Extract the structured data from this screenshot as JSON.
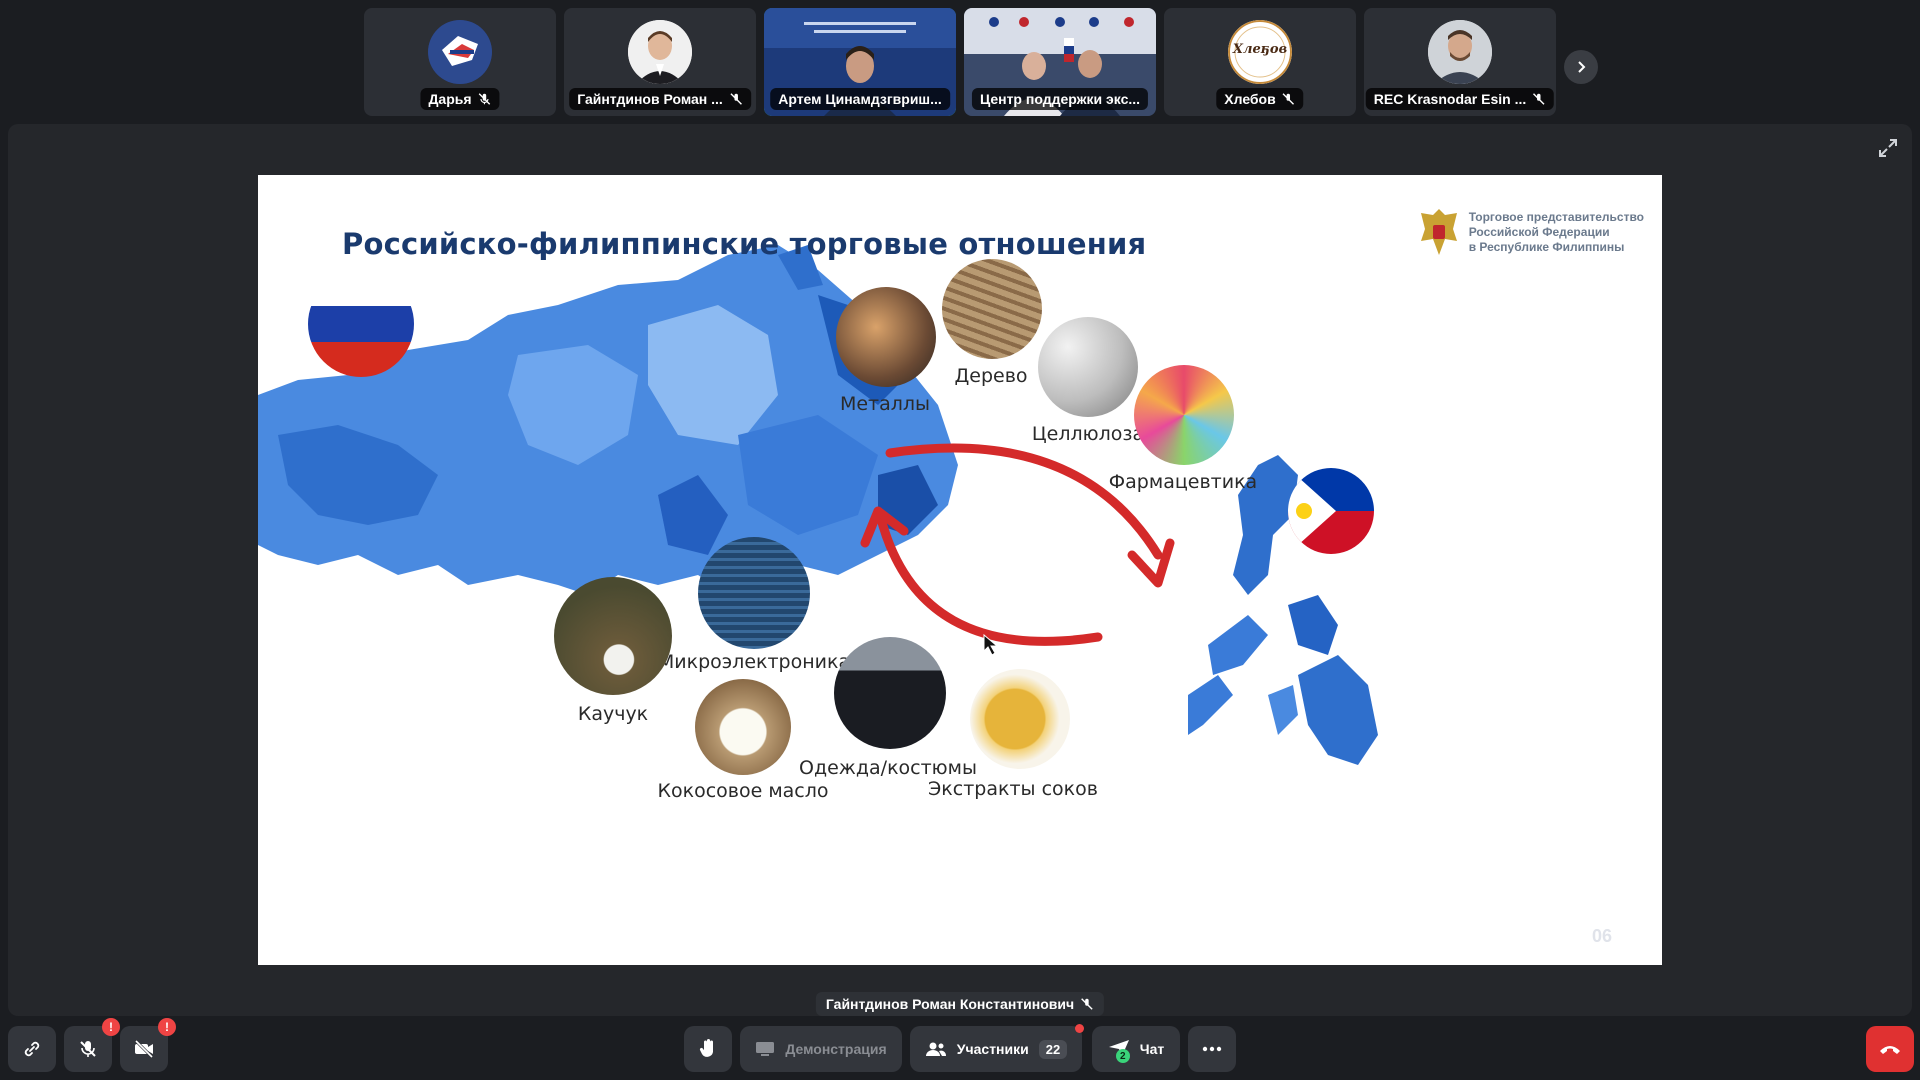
{
  "participants": [
    {
      "name": "Дарья",
      "muted": true,
      "icon": "logo-avatar"
    },
    {
      "name": "Гайнтдинов Роман ...",
      "muted": true,
      "icon": "person-avatar"
    },
    {
      "name": "Артем Цинамдзгвриш...",
      "muted": false,
      "icon": "video-feed",
      "active": true
    },
    {
      "name": "Центр поддержки экс...",
      "muted": false,
      "icon": "video-feed"
    },
    {
      "name": "Хлебов",
      "muted": true,
      "icon": "logo-avatar",
      "logo_text": "Хлеҕов"
    },
    {
      "name": "REC Krasnodar Esin ...",
      "muted": true,
      "icon": "person-avatar"
    }
  ],
  "slide": {
    "title": "Российско-филиппинские торговые отношения",
    "trade_mission": [
      "Торговое представительство",
      "Российской Федерации",
      "в Республике Филиппины"
    ],
    "page_number": "06",
    "exports_from_russia": [
      "Металлы",
      "Дерево",
      "Целлюлоза",
      "Фармацевтика"
    ],
    "imports_to_russia": [
      "Микроэлектроника",
      "Каучук",
      "Кокосовое масло",
      "Одежда/костюмы",
      "Экстракты соков"
    ]
  },
  "active_speaker": "Гайнтдинов Роман Константинович",
  "toolbar": {
    "demo_label": "Демонстрация",
    "participants_label": "Участники",
    "participants_count": "22",
    "chat_label": "Чат",
    "chat_badge": "2",
    "mic_badge": "!",
    "camera_badge": "!"
  },
  "colors": {
    "accent_green": "#3ad47a",
    "end_call": "#e03131",
    "arrow_red": "#d42a2a",
    "map_blue": "#3f7fd6",
    "title_navy": "#1a3a6e"
  }
}
